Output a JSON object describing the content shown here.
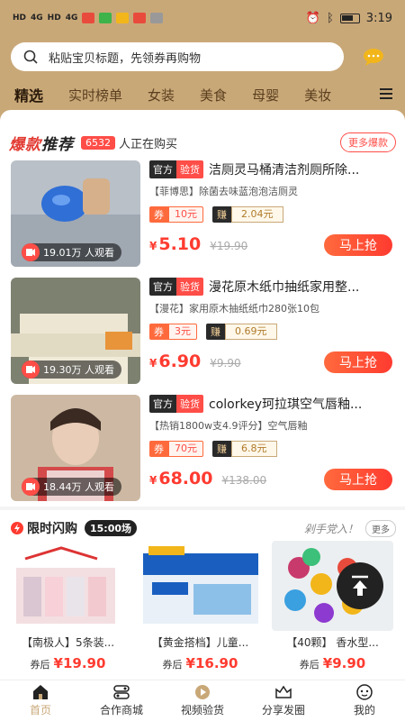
{
  "status": {
    "left_items": [
      "HD",
      "4G",
      "HD",
      "4G"
    ],
    "time": "3:19"
  },
  "search": {
    "placeholder": "粘贴宝贝标题，先领券再购物"
  },
  "tabs": [
    "精选",
    "实时榜单",
    "女装",
    "美食",
    "母婴",
    "美妆"
  ],
  "hot": {
    "title_part1": "爆款",
    "title_part2": "推荐",
    "count": "6532",
    "count_text": "人正在购买",
    "more_label": "更多爆款"
  },
  "products": [
    {
      "tag_official": "官方",
      "tag_verified": "验货",
      "title": "洁厕灵马桶清洁剂厕所除...",
      "subtitle": "【菲博思】除菌去味蓝泡泡洁厕灵",
      "coupon_label": "券",
      "coupon_value": "10元",
      "earn_label": "赚",
      "earn_value": "2.04元",
      "price_yen": "¥",
      "price": "5.10",
      "original": "¥19.90",
      "viewers": "19.01万 人观看",
      "buy_label": "马上抢",
      "img_colors": [
        "#9aa4b0",
        "#2f6fd6"
      ]
    },
    {
      "tag_official": "官方",
      "tag_verified": "验货",
      "title": "漫花原木纸巾抽纸家用整...",
      "subtitle": "【漫花】家用原木抽纸纸巾280张10包",
      "coupon_label": "券",
      "coupon_value": "3元",
      "earn_label": "赚",
      "earn_value": "0.69元",
      "price_yen": "¥",
      "price": "6.90",
      "original": "¥9.90",
      "viewers": "19.30万 人观看",
      "buy_label": "马上抢",
      "img_colors": [
        "#8d8f7a",
        "#e9e2cc"
      ]
    },
    {
      "tag_official": "官方",
      "tag_verified": "验货",
      "title": "colorkey珂拉琪空气唇釉...",
      "subtitle": "【热销1800w支4.9评分】空气唇釉",
      "coupon_label": "券",
      "coupon_value": "70元",
      "earn_label": "赚",
      "earn_value": "6.8元",
      "price_yen": "¥",
      "price": "68.00",
      "original": "¥138.00",
      "viewers": "18.44万 人观看",
      "buy_label": "马上抢",
      "img_colors": [
        "#c9b6a0",
        "#e8d4c4"
      ]
    }
  ],
  "flash": {
    "title": "限时闪购",
    "time": "15:00场",
    "slogan": "剁手党入！",
    "more": "更多",
    "items": [
      {
        "name": "【南极人】5条装...",
        "price_label": "券后",
        "price": "¥19.90",
        "img_colors": [
          "#f0d8dc",
          "#d8c8d0"
        ]
      },
      {
        "name": "【黄金搭档】儿童...",
        "price_label": "券后",
        "price": "¥16.90",
        "img_colors": [
          "#1a5fbf",
          "#f2f6fb"
        ]
      },
      {
        "name": "【40颗】 香水型...",
        "price_label": "券后",
        "price": "¥9.90",
        "img_colors": [
          "#e8e8ea",
          "#c83a6c"
        ]
      }
    ]
  },
  "nav": [
    {
      "label": "首页",
      "icon": "home-icon"
    },
    {
      "label": "合作商城",
      "icon": "store-icon"
    },
    {
      "label": "视频验货",
      "icon": "video-verify-icon"
    },
    {
      "label": "分享发圈",
      "icon": "share-icon"
    },
    {
      "label": "我的",
      "icon": "profile-icon"
    }
  ],
  "colors": {
    "brand": "#c9a878",
    "accent": "#ff3b30"
  }
}
